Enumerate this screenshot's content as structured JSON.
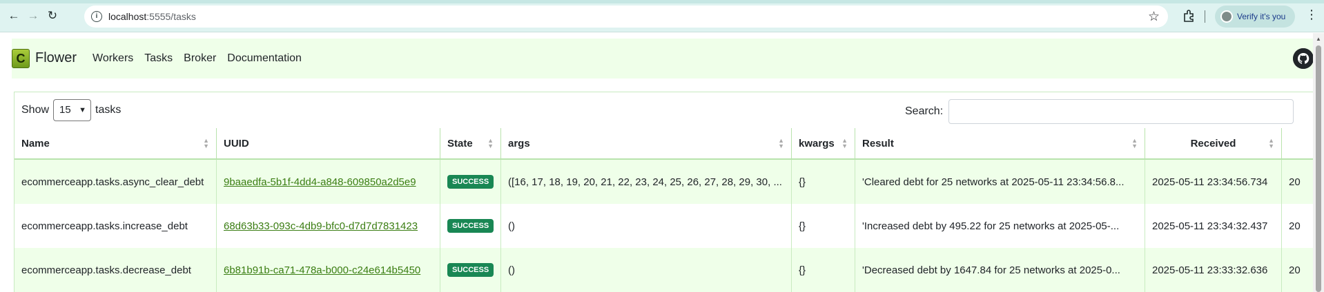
{
  "browser": {
    "url_host": "localhost",
    "url_path": ":5555/tasks",
    "verify_label": "Verify it's you"
  },
  "navbar": {
    "logo_letter": "C",
    "brand": "Flower",
    "links": [
      "Workers",
      "Tasks",
      "Broker",
      "Documentation"
    ]
  },
  "controls": {
    "show_label": "Show",
    "page_size": "15",
    "tasks_label": "tasks",
    "search_label": "Search:"
  },
  "table": {
    "columns": [
      "Name",
      "UUID",
      "State",
      "args",
      "kwargs",
      "Result",
      "Received"
    ],
    "rows": [
      {
        "name": "ecommerceapp.tasks.async_clear_debt",
        "uuid": "9baaedfa-5b1f-4dd4-a848-609850a2d5e9",
        "state": "SUCCESS",
        "args": "([16, 17, 18, 19, 20, 21, 22, 23, 24, 25, 26, 27, 28, 29, 30, ...",
        "kwargs": "{}",
        "result": "'Cleared debt for 25 networks at 2025-05-11 23:34:56.8...",
        "received": "2025-05-11 23:34:56.734",
        "next": "20"
      },
      {
        "name": "ecommerceapp.tasks.increase_debt",
        "uuid": "68d63b33-093c-4db9-bfc0-d7d7d7831423",
        "state": "SUCCESS",
        "args": "()",
        "kwargs": "{}",
        "result": "'Increased debt by 495.22 for 25 networks at 2025-05-...",
        "received": "2025-05-11 23:34:32.437",
        "next": "20"
      },
      {
        "name": "ecommerceapp.tasks.decrease_debt",
        "uuid": "6b81b91b-ca71-478a-b000-c24e614b5450",
        "state": "SUCCESS",
        "args": "()",
        "kwargs": "{}",
        "result": "'Decreased debt by 1647.84 for 25 networks at 2025-0...",
        "received": "2025-05-11 23:33:32.636",
        "next": "20"
      }
    ]
  }
}
